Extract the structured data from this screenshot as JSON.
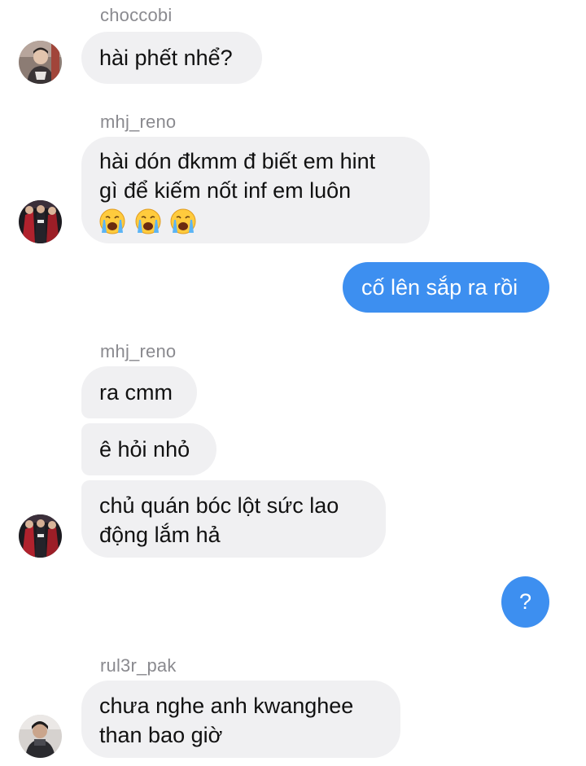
{
  "messages": {
    "m1": {
      "sender": "choccobi",
      "text": "hài phết nhể?"
    },
    "m2": {
      "sender": "mhj_reno",
      "line1": "hài dón đkmm đ biết em hint",
      "line2": "gì để kiếm nốt inf em luôn",
      "emoji": "loudly-crying-face x3"
    },
    "m3": {
      "text": "cố lên sắp ra rồi"
    },
    "m4": {
      "sender": "mhj_reno",
      "text": "ra cmm"
    },
    "m5": {
      "text": "ê hỏi nhỏ"
    },
    "m6": {
      "line1": "chủ quán bóc lột sức lao",
      "line2": "động lắm hả"
    },
    "m7": {
      "text": "?"
    },
    "m8": {
      "sender": "rul3r_pak",
      "line1": "chưa nghe anh kwanghee",
      "line2": "than bao giờ"
    }
  },
  "colors": {
    "incoming_bubble": "#f0f0f2",
    "outgoing_bubble": "#3d8ff0",
    "sender_name": "#8a8a8f"
  }
}
